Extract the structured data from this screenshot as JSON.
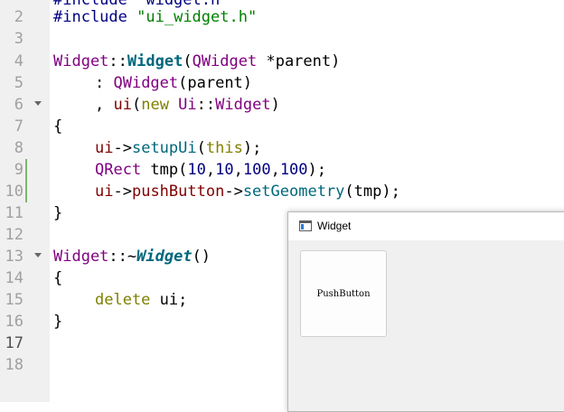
{
  "editor": {
    "line_numbers": [
      "2",
      "3",
      "4",
      "5",
      "6",
      "7",
      "8",
      "9",
      "10",
      "11",
      "12",
      "13",
      "14",
      "15",
      "16",
      "17",
      "18"
    ],
    "top_partial_text": "#include \"widget.h\"",
    "lines": {
      "l2": {
        "prep": "#include",
        "str": "\"ui_widget.h\""
      },
      "l4": {
        "cls": "Widget",
        "sep": "::",
        "fn": "Widget",
        "open": "(",
        "type": "QWidget",
        "rest": " *parent)"
      },
      "l5": {
        "colon": ": ",
        "type": "QWidget",
        "rest": "(parent)"
      },
      "l6": {
        "comma": ", ",
        "member": "ui",
        "open": "(",
        "kw": "new",
        "ns": " Ui",
        "sep": "::",
        "type": "Widget",
        "close": ")"
      },
      "l7": {
        "brace": "{"
      },
      "l8": {
        "member": "ui",
        "arrow": "->",
        "method": "setupUi",
        "open": "(",
        "kw": "this",
        "close": ");"
      },
      "l9": {
        "type": "QRect",
        "rest1": " tmp(",
        "n1": "10",
        "c1": ",",
        "n2": "10",
        "c2": ",",
        "n3": "100",
        "c3": ",",
        "n4": "100",
        "close": ");"
      },
      "l10": {
        "member": "ui",
        "arrow1": "->",
        "member2": "pushButton",
        "arrow2": "->",
        "method": "setGeometry",
        "rest": "(tmp);"
      },
      "l11": {
        "brace": "}"
      },
      "l13": {
        "cls": "Widget",
        "sep": "::~",
        "fn": "Widget",
        "rest": "()"
      },
      "l14": {
        "brace": "{"
      },
      "l15": {
        "kw": "delete",
        "rest": " ui;"
      },
      "l16": {
        "brace": "}"
      }
    }
  },
  "widget_window": {
    "title": "Widget",
    "push_button_label": "PushButton"
  }
}
